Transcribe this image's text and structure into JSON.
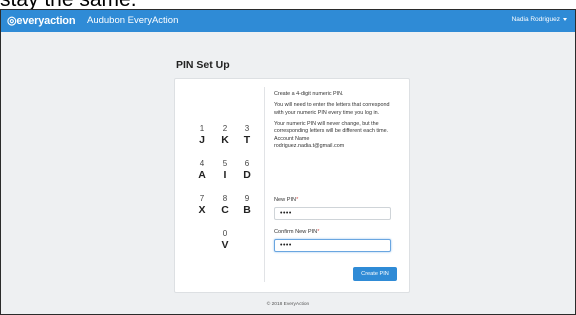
{
  "caption": {
    "text": "stay the same."
  },
  "header": {
    "logo_text": "everyaction",
    "org_name": "Audubon EveryAction",
    "user_name": "Nadia Rodriguez"
  },
  "page": {
    "title": "PIN Set Up"
  },
  "keypad": {
    "keys": [
      {
        "num": "1",
        "letter": "J"
      },
      {
        "num": "2",
        "letter": "K"
      },
      {
        "num": "3",
        "letter": "T"
      },
      {
        "num": "4",
        "letter": "A"
      },
      {
        "num": "5",
        "letter": "I"
      },
      {
        "num": "6",
        "letter": "D"
      },
      {
        "num": "7",
        "letter": "X"
      },
      {
        "num": "8",
        "letter": "C"
      },
      {
        "num": "9",
        "letter": "B"
      },
      {
        "num": "0",
        "letter": "V"
      }
    ]
  },
  "info": {
    "line1": "Create a 4-digit numeric PIN.",
    "line2": "You will need to enter the letters that correspond with your numeric PIN every time you log in.",
    "line3": "Your numeric PIN will never change, but the corresponding letters will be different each time.",
    "account_label": "Account Name",
    "account_email": "rodriguez.nadia.t@gmail.com"
  },
  "form": {
    "new_pin_label": "New PIN",
    "new_pin_value": "••••",
    "confirm_pin_label": "Confirm New PIN",
    "confirm_pin_value": "••••",
    "required_mark": "*",
    "submit_label": "Create PIN"
  },
  "footer": {
    "text": "© 2018 EveryAction"
  },
  "colors": {
    "brand": "#2f8bd6",
    "background": "#eef0f2",
    "required": "#d9534f"
  }
}
